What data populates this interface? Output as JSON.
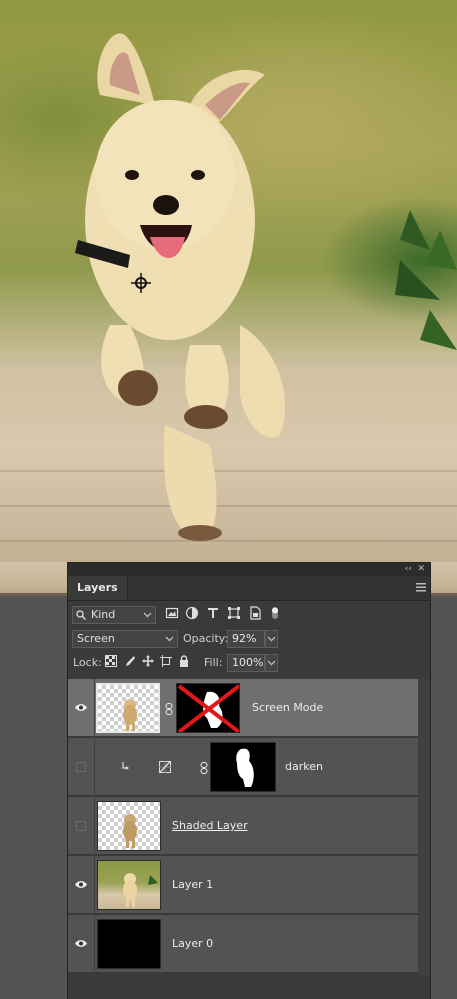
{
  "panel": {
    "collapse_glyph": "‹‹",
    "close_glyph": "✕",
    "tab_label": "Layers",
    "menu_icon": "panel-menu-icon"
  },
  "filter": {
    "kind_label": "Kind",
    "icons": [
      "pixel-filter-icon",
      "adjustment-filter-icon",
      "type-filter-icon",
      "shape-filter-icon",
      "smart-object-filter-icon",
      "filter-toggle-icon"
    ]
  },
  "blend": {
    "mode": "Screen",
    "opacity_label": "Opacity:",
    "opacity_value": "92%"
  },
  "lock": {
    "label": "Lock:",
    "icons": [
      "lock-transparent-icon",
      "lock-image-icon",
      "lock-position-icon",
      "lock-artboard-icon",
      "lock-all-icon"
    ],
    "fill_label": "Fill:",
    "fill_value": "100%"
  },
  "layers": [
    {
      "name": "Screen Mode",
      "visible": true,
      "selected": true,
      "mask": "disabled"
    },
    {
      "name": "darken",
      "visible": false,
      "selected": false,
      "type": "adjustment",
      "clipped": true
    },
    {
      "name": "Shaded Layer",
      "visible": false,
      "selected": false
    },
    {
      "name": "Layer 1",
      "visible": true,
      "selected": false
    },
    {
      "name": "Layer 0",
      "visible": true,
      "selected": false
    }
  ],
  "colors": {
    "panel_bg": "#3a3a3a",
    "row_bg": "#535353",
    "row_selected": "#6f6f6f",
    "mask_disabled_x": "#e01818"
  }
}
